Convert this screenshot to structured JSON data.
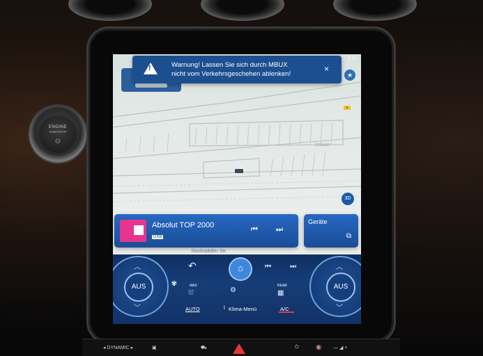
{
  "engine_button": {
    "line1": "ENGINE",
    "line2": "START/STOP"
  },
  "warning": {
    "line1": "Warnung! Lassen Sie sich durch MBUX",
    "line2": "nicht vom Verkehrsgeschehen ablenken!",
    "close": "×"
  },
  "status": {
    "time": "1:11"
  },
  "map": {
    "street_label_1": "Stölpstr.",
    "street_label_2": "Stockstädter Str.",
    "view_button": "3D",
    "road_badge": "B"
  },
  "media": {
    "title": "Absolut TOP 2000",
    "source_tag": "DAB",
    "prev": "⏮",
    "next": "⏭"
  },
  "devices": {
    "title": "Geräte",
    "icon": "phone-link-icon"
  },
  "climate": {
    "left_dial": "AUS",
    "right_dial": "AUS",
    "auto": "AUTO",
    "klima_menu": "Klima-Menü",
    "ac": "A/C",
    "max_label": "MAX",
    "rear_label": "REAR",
    "back": "↶",
    "prev": "⏮",
    "next": "⏭",
    "home": "⌂"
  },
  "bottom": {
    "dynamic": "◂ DYNAMIC ▸",
    "power": "⏻",
    "mute": "🔇"
  },
  "colors": {
    "accent": "#1c4f8f",
    "card": "#2668c1",
    "ac_active": "#e63c3c"
  }
}
